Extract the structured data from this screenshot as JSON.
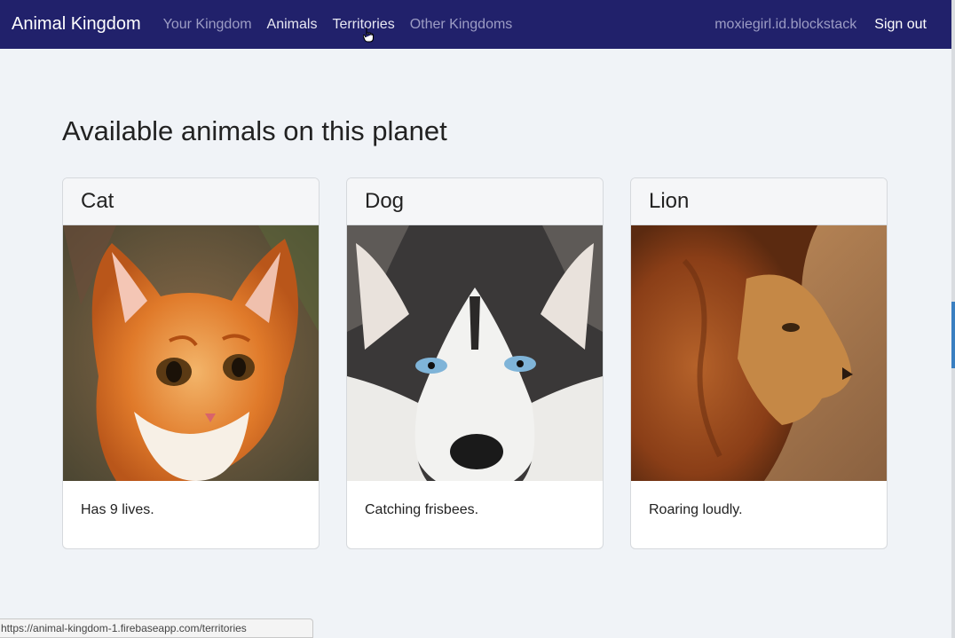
{
  "navbar": {
    "brand": "Animal Kingdom",
    "links": [
      {
        "label": "Your Kingdom"
      },
      {
        "label": "Animals"
      },
      {
        "label": "Territories"
      },
      {
        "label": "Other Kingdoms"
      }
    ],
    "user": "moxiegirl.id.blockstack",
    "sign_out": "Sign out"
  },
  "page": {
    "title": "Available animals on this planet"
  },
  "cards": [
    {
      "name": "Cat",
      "description": "Has 9 lives.",
      "icon": "cat-photo"
    },
    {
      "name": "Dog",
      "description": "Catching frisbees.",
      "icon": "husky-photo"
    },
    {
      "name": "Lion",
      "description": "Roaring loudly.",
      "icon": "lion-photo"
    }
  ],
  "status_bar": {
    "url": "https://animal-kingdom-1.firebaseapp.com/territories"
  },
  "colors": {
    "navbar": "#21216b",
    "background": "#f0f3f7"
  }
}
